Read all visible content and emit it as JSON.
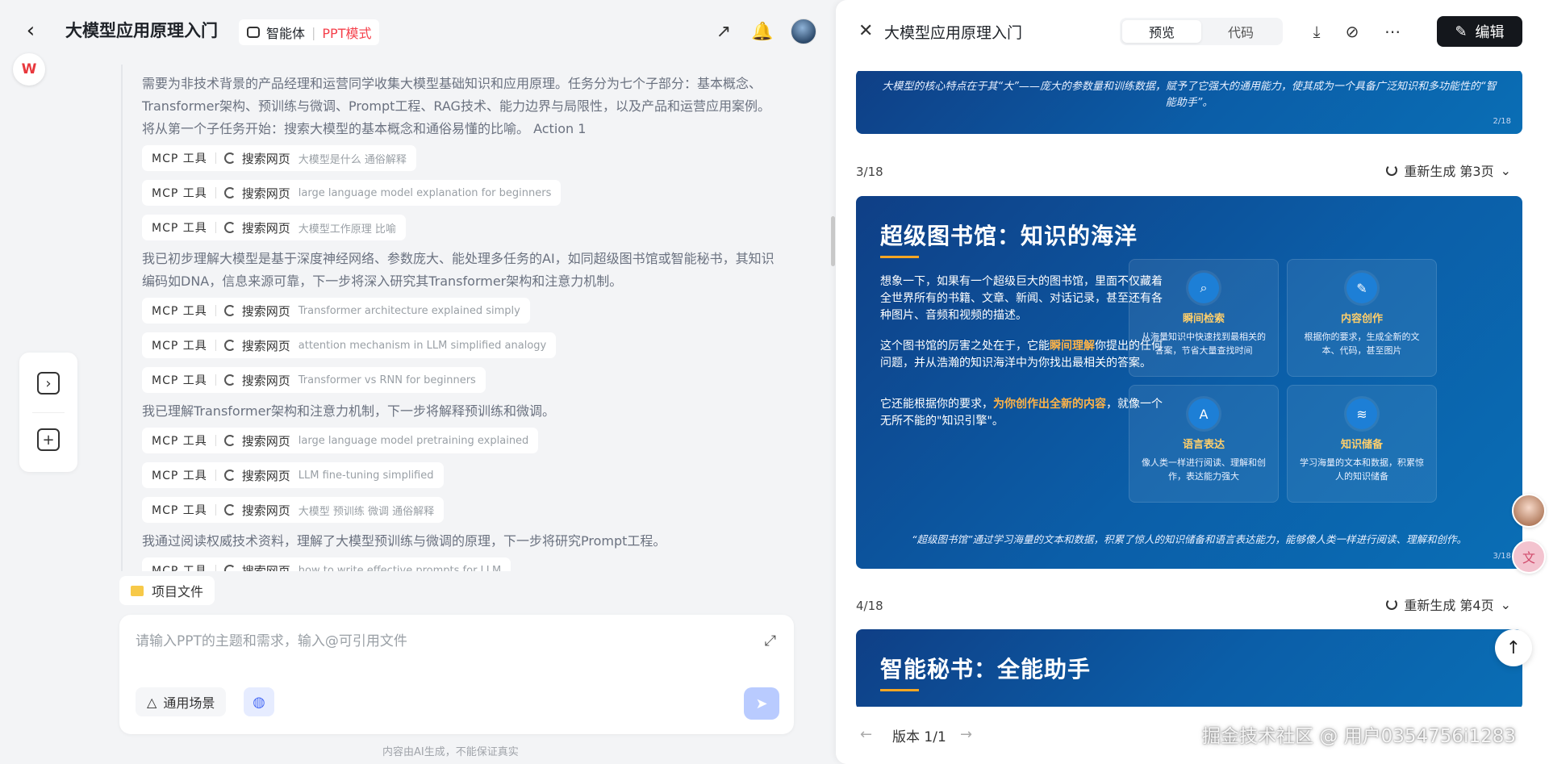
{
  "header": {
    "title": "大模型应用原理入门",
    "agent_label": "智能体",
    "mode_label": "PPT模式"
  },
  "feed": [
    {
      "type": "text",
      "text": "需要为非技术背景的产品经理和运营同学收集大模型基础知识和应用原理。任务分为七个子部分：基本概念、Transformer架构、预训练与微调、Prompt工程、RAG技术、能力边界与局限性，以及产品和运营应用案例。 将从第一个子任务开始：搜索大模型的基本概念和通俗易懂的比喻。 Action 1"
    },
    {
      "type": "tool",
      "mcp": "MCP 工具",
      "action": "搜索网页",
      "query": "大模型是什么 通俗解释"
    },
    {
      "type": "tool",
      "mcp": "MCP 工具",
      "action": "搜索网页",
      "query": "large language model explanation for beginners"
    },
    {
      "type": "tool",
      "mcp": "MCP 工具",
      "action": "搜索网页",
      "query": "大模型工作原理 比喻"
    },
    {
      "type": "text",
      "text": "我已初步理解大模型是基于深度神经网络、参数庞大、能处理多任务的AI，如同超级图书馆或智能秘书，其知识编码如DNA，信息来源可靠，下一步将深入研究其Transformer架构和注意力机制。"
    },
    {
      "type": "tool",
      "mcp": "MCP 工具",
      "action": "搜索网页",
      "query": "Transformer architecture explained simply"
    },
    {
      "type": "tool",
      "mcp": "MCP 工具",
      "action": "搜索网页",
      "query": "attention mechanism in LLM simplified analogy"
    },
    {
      "type": "tool",
      "mcp": "MCP 工具",
      "action": "搜索网页",
      "query": "Transformer vs RNN for beginners"
    },
    {
      "type": "text",
      "text": "我已理解Transformer架构和注意力机制，下一步将解释预训练和微调。"
    },
    {
      "type": "tool",
      "mcp": "MCP 工具",
      "action": "搜索网页",
      "query": "large language model pretraining explained"
    },
    {
      "type": "tool",
      "mcp": "MCP 工具",
      "action": "搜索网页",
      "query": "LLM fine-tuning simplified"
    },
    {
      "type": "tool",
      "mcp": "MCP 工具",
      "action": "搜索网页",
      "query": "大模型 预训练 微调 通俗解释"
    },
    {
      "type": "text",
      "text": "我通过阅读权威技术资料，理解了大模型预训练与微调的原理，下一步将研究Prompt工程。"
    },
    {
      "type": "tool",
      "mcp": "MCP 工具",
      "action": "搜索网页",
      "query": "how to write effective prompts for LLM"
    }
  ],
  "project_files_label": "项目文件",
  "composer": {
    "placeholder": "请输入PPT的主题和需求，输入@可引用文件",
    "scene_label": "通用场景"
  },
  "disclaimer": "内容由AI生成，不能保证真实",
  "preview": {
    "title": "大模型应用原理入门",
    "tab_preview": "预览",
    "tab_code": "代码",
    "edit_label": "编辑",
    "slide2": {
      "quote": "大模型的核心特点在于其“大”——庞大的参数量和训练数据，赋予了它强大的通用能力，使其成为一个具备广泛知识和多功能性的“智能助手”。",
      "page": "2/18"
    },
    "slide3": {
      "counter": "3/18",
      "regen_label": "重新生成 第3页",
      "title": "超级图书馆：知识的海洋",
      "p1": "想象一下，如果有一个超级巨大的图书馆，里面不仅藏着全世界所有的书籍、文章、新闻、对话记录，甚至还有各种图片、音频和视频的描述。",
      "p2_a": "这个图书馆的厉害之处在于，它能",
      "p2_hl": "瞬间理解",
      "p2_b": "你提出的任何问题，并从浩瀚的知识海洋中为你找出最相关的答案。",
      "p3_a": "它还能根据你的要求，",
      "p3_hl": "为你创作出全新的内容",
      "p3_b": "，就像一个无所不能的\"知识引擎\"。",
      "cards": [
        {
          "title": "瞬间检索",
          "desc": "从海量知识中快速找到最相关的答案，节省大量查找时间",
          "icon": "magnifier-icon"
        },
        {
          "title": "内容创作",
          "desc": "根据你的要求，生成全新的文本、代码，甚至图片",
          "icon": "brush-icon"
        },
        {
          "title": "语言表达",
          "desc": "像人类一样进行阅读、理解和创作，表达能力强大",
          "icon": "translate-icon"
        },
        {
          "title": "知识储备",
          "desc": "学习海量的文本和数据，积累惊人的知识储备",
          "icon": "database-icon"
        }
      ],
      "bottom_quote": "“超级图书馆”通过学习海量的文本和数据，积累了惊人的知识储备和语言表达能力，能够像人类一样进行阅读、理解和创作。",
      "page": "3/18"
    },
    "slide4": {
      "counter": "4/18",
      "regen_label": "重新生成 第4页",
      "title": "智能秘书：全能助手"
    },
    "version_label": "版本 1/1"
  },
  "watermark": "掘金技术社区 @ 用户0354756i1283"
}
